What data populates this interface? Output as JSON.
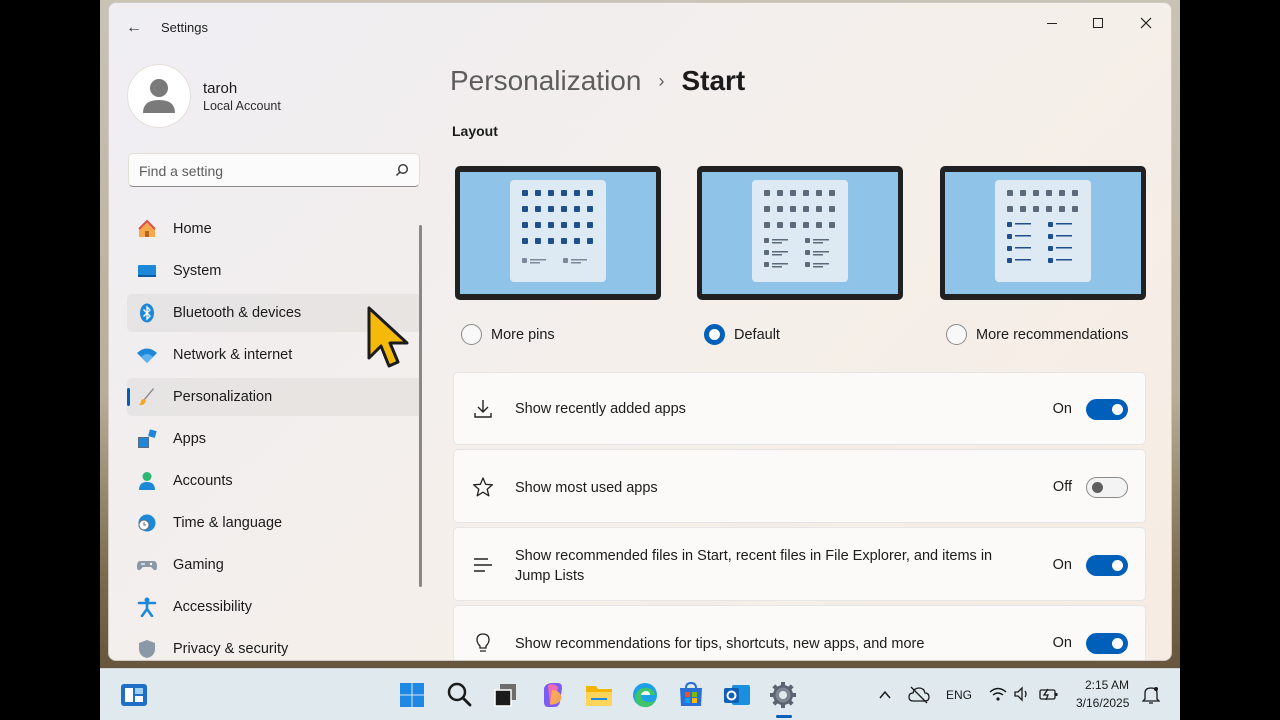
{
  "window": {
    "title": "Settings",
    "back_icon": "arrow-left-icon",
    "controls": [
      "minimize-icon",
      "maximize-icon",
      "close-icon"
    ]
  },
  "user": {
    "name": "taroh",
    "account_type": "Local Account"
  },
  "search": {
    "placeholder": "Find a setting"
  },
  "sidebar": {
    "items": [
      {
        "label": "Home",
        "icon": "home-icon"
      },
      {
        "label": "System",
        "icon": "system-icon"
      },
      {
        "label": "Bluetooth & devices",
        "icon": "bluetooth-icon"
      },
      {
        "label": "Network & internet",
        "icon": "wifi-icon"
      },
      {
        "label": "Personalization",
        "icon": "brush-icon"
      },
      {
        "label": "Apps",
        "icon": "apps-icon"
      },
      {
        "label": "Accounts",
        "icon": "accounts-icon"
      },
      {
        "label": "Time & language",
        "icon": "globe-clock-icon"
      },
      {
        "label": "Gaming",
        "icon": "gamepad-icon"
      },
      {
        "label": "Accessibility",
        "icon": "accessibility-icon"
      },
      {
        "label": "Privacy & security",
        "icon": "shield-icon"
      }
    ],
    "active": "Personalization",
    "hovered": "Bluetooth & devices"
  },
  "breadcrumb": {
    "parent": "Personalization",
    "separator": "›",
    "current": "Start"
  },
  "layout": {
    "heading": "Layout",
    "options": [
      {
        "label": "More pins",
        "selected": false
      },
      {
        "label": "Default",
        "selected": true
      },
      {
        "label": "More recommendations",
        "selected": false
      }
    ]
  },
  "settings": [
    {
      "label": "Show recently added apps",
      "state": "On",
      "on": true,
      "icon": "download-icon"
    },
    {
      "label": "Show most used apps",
      "state": "Off",
      "on": false,
      "icon": "star-icon"
    },
    {
      "label": "Show recommended files in Start, recent files in File Explorer, and items in Jump Lists",
      "state": "On",
      "on": true,
      "icon": "list-icon"
    },
    {
      "label": "Show recommendations for tips, shortcuts, new apps, and more",
      "state": "On",
      "on": true,
      "icon": "lightbulb-icon"
    }
  ],
  "taskbar": {
    "apps": [
      "widgets-icon",
      "windows-start-icon",
      "search-icon",
      "task-view-icon",
      "copilot-icon",
      "file-explorer-icon",
      "edge-icon",
      "store-icon",
      "outlook-icon",
      "settings-icon"
    ],
    "tray": {
      "language": "ENG",
      "time": "2:15 AM",
      "date": "3/16/2025"
    }
  },
  "colors": {
    "accent": "#005fb8",
    "screen_blue": "#8fc4e8"
  }
}
